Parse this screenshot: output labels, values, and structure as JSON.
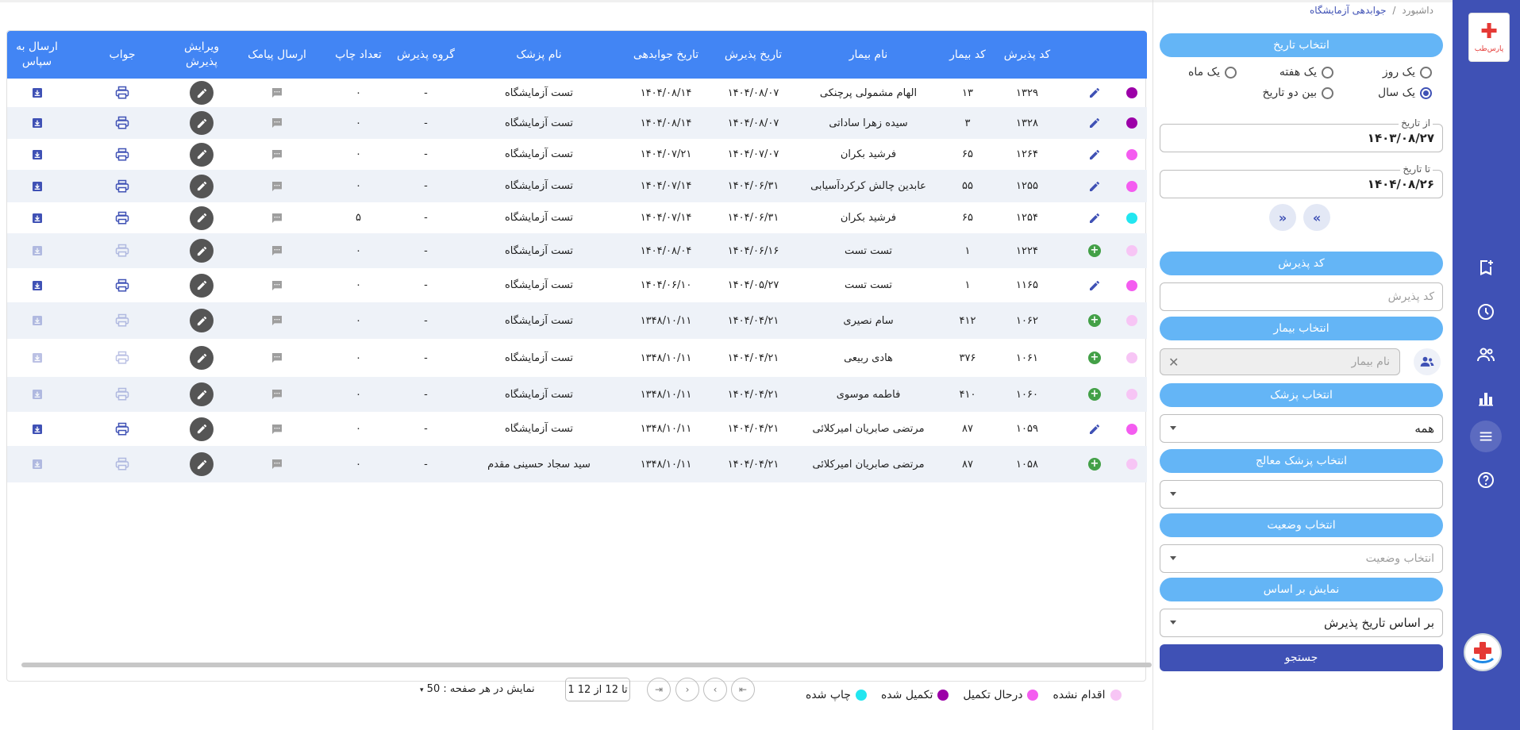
{
  "breadcrumb": {
    "home": "داشبورد",
    "separator": "/",
    "current": "جوابدهی آزمایشگاه"
  },
  "brand": {
    "logo_text": "پارس‌طب"
  },
  "filters": {
    "date_section": "انتخاب تاریخ",
    "period_options": [
      "یک روز",
      "یک هفته",
      "یک ماه",
      "یک سال",
      "بین دو تاریخ"
    ],
    "period_selected": "یک سال",
    "from_label": "از تاریخ",
    "from_value": "۱۴۰۳/۰۸/۲۷",
    "to_label": "تا تاریخ",
    "to_value": "۱۴۰۴/۰۸/۲۶",
    "nav_prev": "«",
    "nav_next": "»",
    "admission_code_section": "کد پذیرش",
    "admission_code_placeholder": "کد پذیرش",
    "patient_section": "انتخاب بیمار",
    "patient_placeholder": "نام بیمار",
    "doctor_section": "انتخاب پزشک",
    "doctor_value": "همه",
    "treating_doctor_section": "انتخاب پزشک معالج",
    "treating_doctor_value": "",
    "status_section": "انتخاب وضعیت",
    "status_placeholder": "انتخاب وضعیت",
    "display_section": "نمایش بر اساس",
    "display_value": "بر اساس تاریخ پذیرش",
    "search_label": "جستجو"
  },
  "table": {
    "headers": {
      "admission_code": "کد پذیرش",
      "patient_code": "کد بیمار",
      "patient_name": "نام بیمار",
      "admission_date": "تاریخ پذیرش",
      "answer_date": "تاریخ جوابدهی",
      "doctor_name": "نام پزشک",
      "admission_group": "گروه پذیرش",
      "print_count": "تعداد چاپ",
      "send_sms": "ارسال پیامک",
      "edit_admission": "ویرایش پذیرش",
      "answer": "جواب",
      "send_sepas": "ارسال به سپاس"
    },
    "rows": [
      {
        "status_color": "#9c00a8",
        "action": "edit",
        "admission_code": "۱۳۲۹",
        "patient_code": "۱۳",
        "patient_name": "الهام مشمولی پرچنکی",
        "admission_date": "۱۴۰۴/۰۸/۰۷",
        "answer_date": "۱۴۰۴/۰۸/۱۴",
        "doctor_name": "تست آزمایشگاه",
        "group": "-",
        "print_count": "۰",
        "enabled": true
      },
      {
        "status_color": "#9c00a8",
        "action": "edit",
        "admission_code": "۱۳۲۸",
        "patient_code": "۳",
        "patient_name": "سیده زهرا ساداتی",
        "admission_date": "۱۴۰۴/۰۸/۰۷",
        "answer_date": "۱۴۰۴/۰۸/۱۴",
        "doctor_name": "تست آزمایشگاه",
        "group": "-",
        "print_count": "۰",
        "enabled": true
      },
      {
        "status_color": "#f45cf0",
        "action": "edit",
        "admission_code": "۱۲۶۴",
        "patient_code": "۶۵",
        "patient_name": "فرشید بکران",
        "admission_date": "۱۴۰۴/۰۷/۰۷",
        "answer_date": "۱۴۰۴/۰۷/۲۱",
        "doctor_name": "تست آزمایشگاه",
        "group": "-",
        "print_count": "۰",
        "enabled": true
      },
      {
        "status_color": "#f45cf0",
        "action": "edit",
        "admission_code": "۱۲۵۵",
        "patient_code": "۵۵",
        "patient_name": "عابدین چالش کرکردآسیابی",
        "admission_date": "۱۴۰۴/۰۶/۳۱",
        "answer_date": "۱۴۰۴/۰۷/۱۴",
        "doctor_name": "تست آزمایشگاه",
        "group": "-",
        "print_count": "۰",
        "enabled": true
      },
      {
        "status_color": "#22e6f0",
        "action": "edit",
        "admission_code": "۱۲۵۴",
        "patient_code": "۶۵",
        "patient_name": "فرشید بکران",
        "admission_date": "۱۴۰۴/۰۶/۳۱",
        "answer_date": "۱۴۰۴/۰۷/۱۴",
        "doctor_name": "تست آزمایشگاه",
        "group": "-",
        "print_count": "۵",
        "enabled": true
      },
      {
        "status_color": "#f7c5f5",
        "action": "add",
        "admission_code": "۱۲۲۴",
        "patient_code": "۱",
        "patient_name": "تست تست",
        "admission_date": "۱۴۰۴/۰۶/۱۶",
        "answer_date": "۱۴۰۴/۰۸/۰۴",
        "doctor_name": "تست آزمایشگاه",
        "group": "-",
        "print_count": "۰",
        "enabled": false
      },
      {
        "status_color": "#f45cf0",
        "action": "edit",
        "admission_code": "۱۱۶۵",
        "patient_code": "۱",
        "patient_name": "تست تست",
        "admission_date": "۱۴۰۴/۰۵/۲۷",
        "answer_date": "۱۴۰۴/۰۶/۱۰",
        "doctor_name": "تست آزمایشگاه",
        "group": "-",
        "print_count": "۰",
        "enabled": true
      },
      {
        "status_color": "#f7c5f5",
        "action": "add",
        "admission_code": "۱۰۶۲",
        "patient_code": "۴۱۲",
        "patient_name": "سام نصیری",
        "admission_date": "۱۴۰۴/۰۴/۲۱",
        "answer_date": "۱۳۴۸/۱۰/۱۱",
        "doctor_name": "تست آزمایشگاه",
        "group": "-",
        "print_count": "۰",
        "enabled": false
      },
      {
        "status_color": "#f7c5f5",
        "action": "add",
        "admission_code": "۱۰۶۱",
        "patient_code": "۳۷۶",
        "patient_name": "هادی ربیعی",
        "admission_date": "۱۴۰۴/۰۴/۲۱",
        "answer_date": "۱۳۴۸/۱۰/۱۱",
        "doctor_name": "تست آزمایشگاه",
        "group": "-",
        "print_count": "۰",
        "enabled": false
      },
      {
        "status_color": "#f7c5f5",
        "action": "add",
        "admission_code": "۱۰۶۰",
        "patient_code": "۴۱۰",
        "patient_name": "فاطمه موسوی",
        "admission_date": "۱۴۰۴/۰۴/۲۱",
        "answer_date": "۱۳۴۸/۱۰/۱۱",
        "doctor_name": "تست آزمایشگاه",
        "group": "-",
        "print_count": "۰",
        "enabled": false
      },
      {
        "status_color": "#f45cf0",
        "action": "edit",
        "admission_code": "۱۰۵۹",
        "patient_code": "۸۷",
        "patient_name": "مرتضی صابریان امیرکلائی",
        "admission_date": "۱۴۰۴/۰۴/۲۱",
        "answer_date": "۱۳۴۸/۱۰/۱۱",
        "doctor_name": "تست آزمایشگاه",
        "group": "-",
        "print_count": "۰",
        "enabled": true
      },
      {
        "status_color": "#f7c5f5",
        "action": "add",
        "admission_code": "۱۰۵۸",
        "patient_code": "۸۷",
        "patient_name": "مرتضی صابریان امیرکلائی",
        "admission_date": "۱۴۰۴/۰۴/۲۱",
        "answer_date": "۱۳۴۸/۱۰/۱۱",
        "doctor_name": "سید سجاد حسینی مقدم",
        "group": "-",
        "print_count": "۰",
        "enabled": false
      }
    ]
  },
  "pagination": {
    "info": "1 تا 12 از 12",
    "page_size_label": "نمایش در هر صفحه :",
    "page_size": "50"
  },
  "legend": [
    {
      "label": "اقدام نشده",
      "color": "#f7c5f5"
    },
    {
      "label": "درحال تکمیل",
      "color": "#f45cf0"
    },
    {
      "label": "تکمیل شده",
      "color": "#9c00a8"
    },
    {
      "label": "چاپ شده",
      "color": "#22e6f0"
    }
  ],
  "colors": {
    "primary": "#3f51b5",
    "header": "#4285f4",
    "section": "#64b5f6"
  }
}
